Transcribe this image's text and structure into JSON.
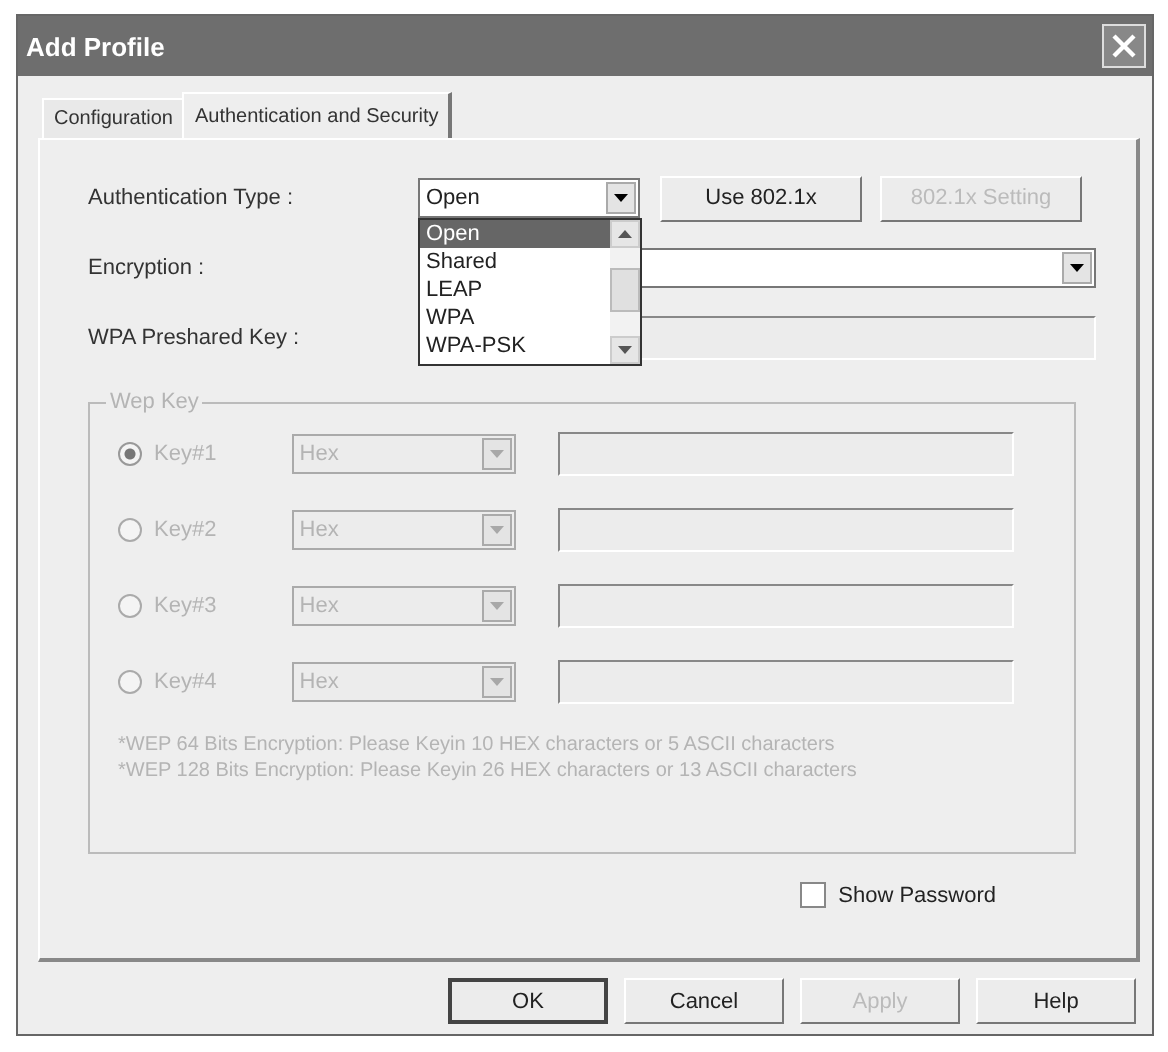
{
  "window": {
    "title": "Add Profile"
  },
  "tabs": [
    {
      "label": "Configuration",
      "selected": false
    },
    {
      "label": "Authentication and Security",
      "selected": true
    }
  ],
  "authentication_type": {
    "label": "Authentication Type :",
    "value": "Open",
    "expanded": true,
    "options": [
      {
        "label": "Open",
        "selected": true
      },
      {
        "label": "Shared",
        "selected": false
      },
      {
        "label": "LEAP",
        "selected": false
      },
      {
        "label": "WPA",
        "selected": false
      },
      {
        "label": "WPA-PSK",
        "selected": false
      }
    ]
  },
  "auth_buttons": [
    {
      "label": "Use 802.1x",
      "disabled": false
    },
    {
      "label": "802.1x Setting",
      "disabled": true
    }
  ],
  "encryption": {
    "label": "Encryption :"
  },
  "wpa_key": {
    "label": "WPA Preshared Key :",
    "disabled": true
  },
  "wep_key": {
    "title": "Wep Key",
    "disabled": true,
    "keys": [
      {
        "label": "Key#1",
        "selected": true,
        "format": "Hex"
      },
      {
        "label": "Key#2",
        "selected": false,
        "format": "Hex"
      },
      {
        "label": "Key#3",
        "selected": false,
        "format": "Hex"
      },
      {
        "label": "Key#4",
        "selected": false,
        "format": "Hex"
      }
    ],
    "notes": [
      "*WEP 64 Bits Encryption: Please Keyin 10 HEX characters or 5 ASCII characters",
      "*WEP 128 Bits Encryption: Please Keyin 26 HEX characters or 13 ASCII characters"
    ]
  },
  "show_password": {
    "label": "Show Password",
    "checked": false
  },
  "buttons": [
    {
      "label": "OK",
      "disabled": false,
      "default": true
    },
    {
      "label": "Cancel",
      "disabled": false,
      "default": false
    },
    {
      "label": "Apply",
      "disabled": true,
      "default": false
    },
    {
      "label": "Help",
      "disabled": false,
      "default": false
    }
  ]
}
